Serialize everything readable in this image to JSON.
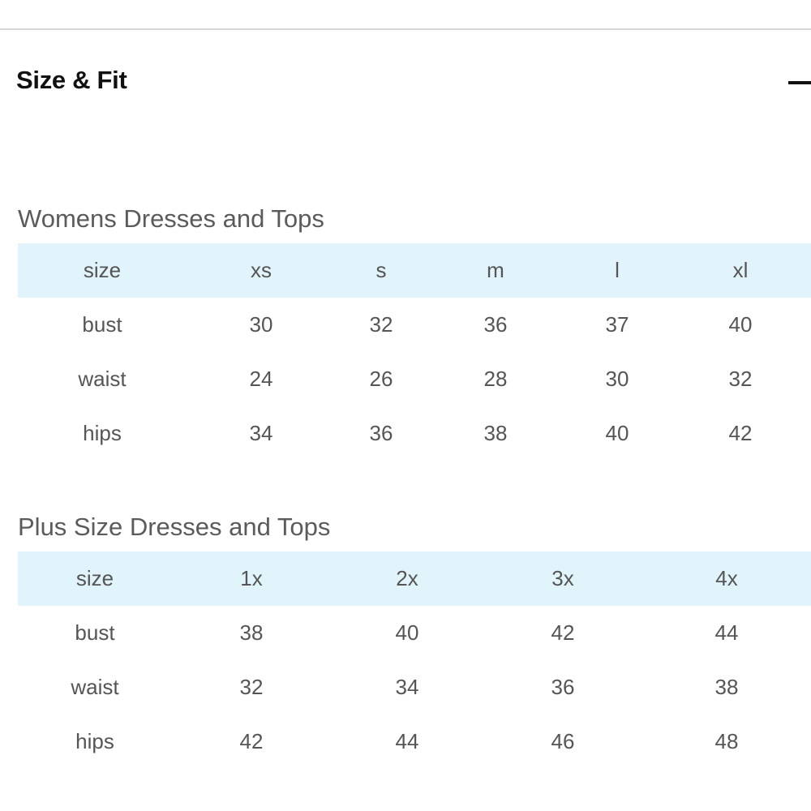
{
  "section": {
    "title": "Size & Fit",
    "toggle_icon": "minus-icon"
  },
  "tables": [
    {
      "title": "Womens Dresses and Tops",
      "header": [
        "size",
        "xs",
        "s",
        "m",
        "l",
        "xl"
      ],
      "rows": [
        [
          "bust",
          "30",
          "32",
          "36",
          "37",
          "40"
        ],
        [
          "waist",
          "24",
          "26",
          "28",
          "30",
          "32"
        ],
        [
          "hips",
          "34",
          "36",
          "38",
          "40",
          "42"
        ]
      ]
    },
    {
      "title": "Plus Size Dresses and Tops",
      "header": [
        "size",
        "1x",
        "2x",
        "3x",
        "4x"
      ],
      "rows": [
        [
          "bust",
          "38",
          "40",
          "42",
          "44"
        ],
        [
          "waist",
          "32",
          "34",
          "36",
          "38"
        ],
        [
          "hips",
          "42",
          "44",
          "46",
          "48"
        ]
      ]
    }
  ],
  "colors": {
    "header_row_bg": "#e1f4fb",
    "title_text": "#111111",
    "table_text": "#555555",
    "divider": "#d6d6d6"
  }
}
